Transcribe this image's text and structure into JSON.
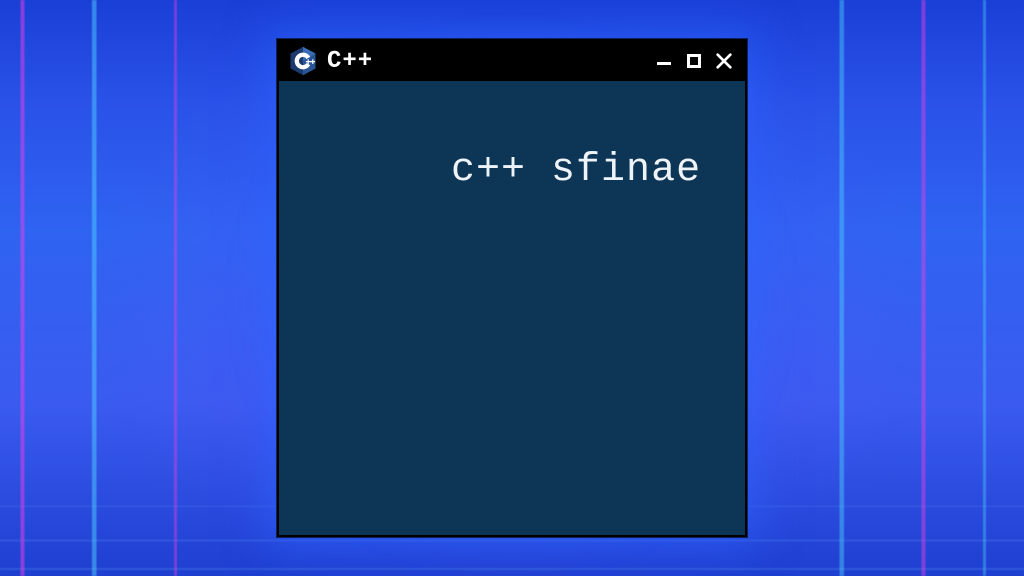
{
  "window": {
    "title": "C++",
    "icon": "cpp-logo",
    "controls": {
      "minimize": "minimize-icon",
      "maximize": "maximize-icon",
      "close": "close-icon"
    }
  },
  "content": {
    "text": "c++ sfinae"
  },
  "colors": {
    "titlebar_bg": "#000000",
    "window_bg": "#0d3556",
    "text": "#eef3f8",
    "glow": "#3c78ff"
  }
}
